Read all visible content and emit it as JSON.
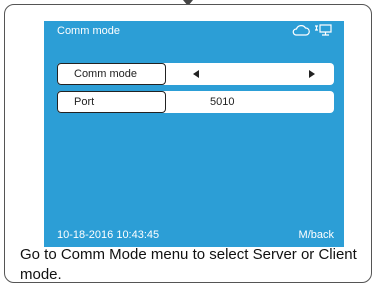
{
  "screen": {
    "title": "Comm mode",
    "background_color": "#2c9ed6",
    "status_icons": [
      "cloud-icon",
      "network-icon"
    ],
    "rows": [
      {
        "label": "Comm mode",
        "value": ""
      },
      {
        "label": "Port",
        "value": "5010"
      }
    ],
    "datetime": "10-18-2016 10:43:45",
    "back_label": "M/back"
  },
  "caption": "Go to Comm Mode menu to select Server or Client mode."
}
